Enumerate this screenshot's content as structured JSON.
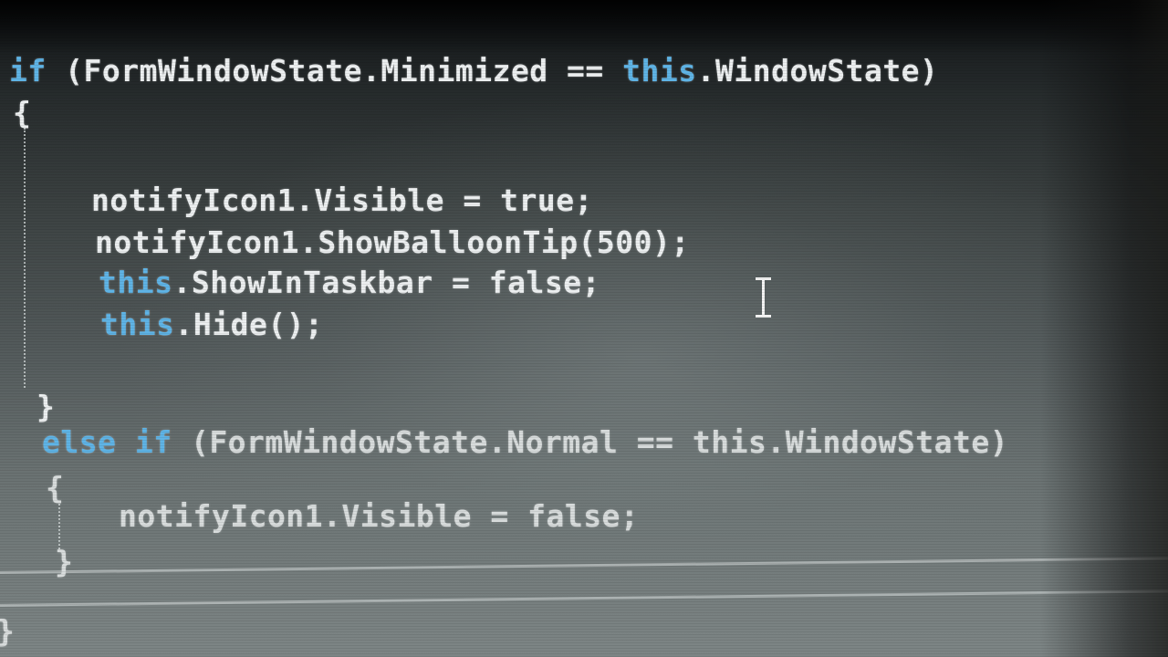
{
  "code": {
    "l1": {
      "kw1": "if",
      "a": " (FormWindowState.Minimized == ",
      "kw2": "this",
      "b": ".WindowState)"
    },
    "l2": {
      "text": "{"
    },
    "l3": {
      "a": "notifyIcon1.Visible = true;"
    },
    "l4": {
      "a": "notifyIcon1.ShowBalloonTip(500);"
    },
    "l5": {
      "kw": "this",
      "a": ".ShowInTaskbar = false;"
    },
    "l6": {
      "kw": "this",
      "a": ".Hide();"
    },
    "l7": {
      "text": "}"
    },
    "l8": {
      "kw": "else if",
      "a": " (FormWindowState.Normal == this.WindowState)"
    },
    "l9": {
      "text": "{"
    },
    "l10": {
      "a": "notifyIcon1.Visible = false;"
    },
    "l11": {
      "text": "}"
    },
    "l12": {
      "text": "}"
    }
  },
  "colors": {
    "keyword": "#5fb4e6",
    "text": "#eceff0"
  },
  "icons": {
    "cursor": "i-beam-cursor-icon"
  }
}
